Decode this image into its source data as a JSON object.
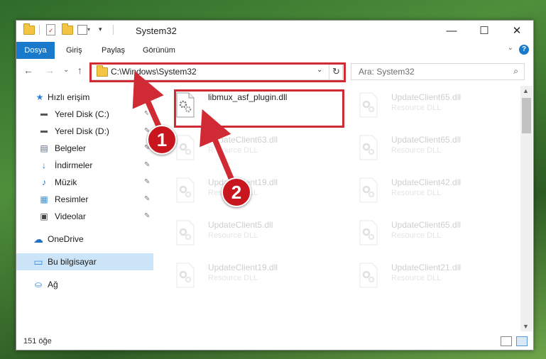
{
  "window": {
    "title": "System32",
    "minimize": "—",
    "maximize": "☐",
    "close": "✕"
  },
  "ribbon": {
    "tabs": [
      "Dosya",
      "Giriş",
      "Paylaş",
      "Görünüm"
    ],
    "help": "?",
    "collapse": "⌄"
  },
  "nav": {
    "back": "←",
    "forward": "→",
    "recent": "⌄",
    "up": "↑",
    "address": "C:\\Windows\\System32",
    "address_dropdown": "⌄",
    "refresh": "↻",
    "search_placeholder": "Ara: System32",
    "search_icon": "⌕"
  },
  "sidebar": {
    "items": [
      {
        "label": "Hızlı erişim",
        "icon": "star-icon",
        "glyph": "★",
        "color": "#2a7fd4"
      },
      {
        "label": "Yerel Disk (C:)",
        "icon": "drive-icon",
        "glyph": "▬",
        "color": "#555555",
        "pinned": true
      },
      {
        "label": "Yerel Disk (D:)",
        "icon": "drive-icon",
        "glyph": "▬",
        "color": "#555555",
        "pinned": true
      },
      {
        "label": "Belgeler",
        "icon": "documents-icon",
        "glyph": "▤",
        "color": "#5a6a80",
        "pinned": true
      },
      {
        "label": "İndirmeler",
        "icon": "download-icon",
        "glyph": "↓",
        "color": "#1f6fc6",
        "pinned": true
      },
      {
        "label": "Müzik",
        "icon": "music-icon",
        "glyph": "♪",
        "color": "#1f6fc6",
        "pinned": true
      },
      {
        "label": "Resimler",
        "icon": "pictures-icon",
        "glyph": "▦",
        "color": "#3b8fd0",
        "pinned": true
      },
      {
        "label": "Videolar",
        "icon": "video-icon",
        "glyph": "▣",
        "color": "#444444",
        "pinned": true
      },
      {
        "label": "OneDrive",
        "icon": "cloud-icon",
        "glyph": "☁",
        "color": "#1f6fc6"
      },
      {
        "label": "Bu bilgisayar",
        "icon": "computer-icon",
        "glyph": "▭",
        "color": "#2f8ad8"
      },
      {
        "label": "Ağ",
        "icon": "network-icon",
        "glyph": "⛀",
        "color": "#2f8ad8"
      }
    ],
    "pin_glyph": "📌"
  },
  "files": [
    {
      "name": "libmux_asf_plugin.dll",
      "type": ""
    },
    {
      "name": "UpdateClient65.dll",
      "type": "Resource DLL"
    },
    {
      "name": "UpdateClient63.dll",
      "type": "Resource DLL"
    },
    {
      "name": "UpdateClient65.dll",
      "type": "Resource DLL"
    },
    {
      "name": "UpdateClient19.dll",
      "type": "Resource DLL"
    },
    {
      "name": "UpdateClient42.dll",
      "type": "Resource DLL"
    },
    {
      "name": "UpdateClient5.dll",
      "type": "Resource DLL"
    },
    {
      "name": "UpdateClient65.dll",
      "type": "Resource DLL"
    },
    {
      "name": "UpdateClient19.dll",
      "type": "Resource DLL"
    },
    {
      "name": "UpdateClient21.dll",
      "type": "Resource DLL"
    }
  ],
  "status": {
    "count": "151 öğe"
  },
  "annotations": {
    "badge1": "1",
    "badge2": "2",
    "color": "#d02b34"
  }
}
